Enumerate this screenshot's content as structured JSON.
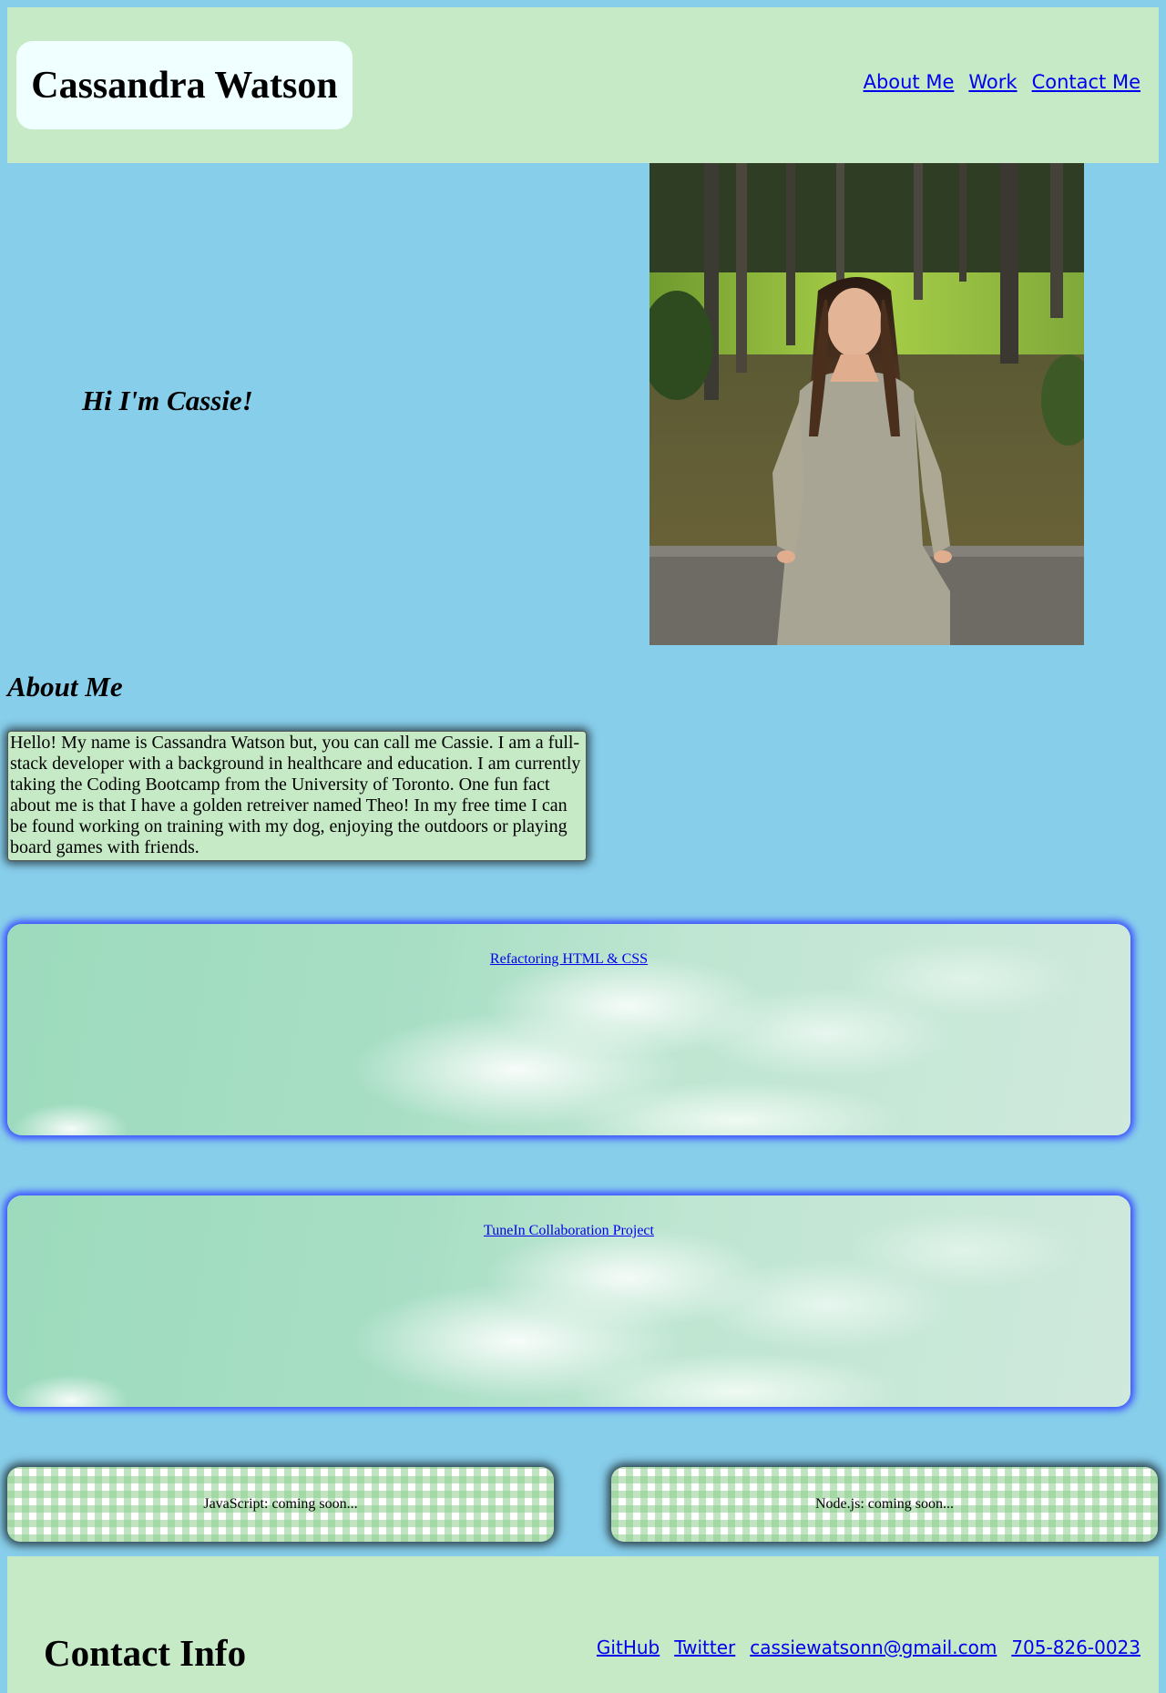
{
  "header": {
    "name": "Cassandra Watson",
    "nav": [
      {
        "label": "About Me"
      },
      {
        "label": "Work"
      },
      {
        "label": "Contact Me"
      }
    ]
  },
  "hero": {
    "greeting": "Hi I'm Cassie!",
    "photo_alt": "Photo of Cassie sitting on a stone wall in a park with trees"
  },
  "about": {
    "heading": "About Me",
    "text": "Hello! My name is Cassandra Watson but, you can call me Cassie. I am a full-stack developer with a background in healthcare and education. I am currently taking the Coding Bootcamp from the University of Toronto. One fun fact about me is that I have a golden retreiver named Theo! In my free time I can be found working on training with my dog, enjoying the outdoors or playing board games with friends."
  },
  "work": {
    "projects": [
      {
        "label": "Refactoring HTML & CSS"
      },
      {
        "label": "TuneIn Collaboration Project"
      }
    ],
    "coming_soon": [
      {
        "label": "JavaScript: coming soon..."
      },
      {
        "label": "Node.js: coming soon..."
      }
    ]
  },
  "footer": {
    "heading": "Contact Info",
    "links": [
      {
        "label": "GitHub"
      },
      {
        "label": "Twitter"
      },
      {
        "label": "cassiewatsonn@gmail.com"
      },
      {
        "label": "705-826-0023"
      }
    ]
  },
  "colors": {
    "page_background": "#87ceeb",
    "header_background": "#c6eac6",
    "name_box_background": "#f0ffff",
    "link": "#0000ee",
    "project_glow": "#3a4dff"
  }
}
